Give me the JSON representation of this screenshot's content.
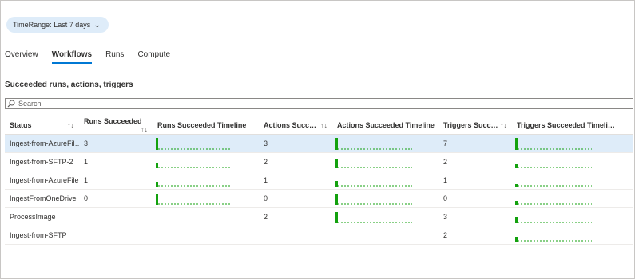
{
  "filter": {
    "label": "TimeRange: Last 7 days",
    "icon": "chevron-down-icon"
  },
  "tabs": [
    {
      "label": "Overview",
      "active": false
    },
    {
      "label": "Workflows",
      "active": true
    },
    {
      "label": "Runs",
      "active": false
    },
    {
      "label": "Compute",
      "active": false
    }
  ],
  "section_title": "Succeeded runs, actions, triggers",
  "search": {
    "placeholder": "Search",
    "value": "",
    "icon": "search-icon"
  },
  "table": {
    "columns": [
      {
        "label": "Status",
        "sortable": true
      },
      {
        "label": "Runs Succeeded",
        "sortable": true
      },
      {
        "label": "Runs Succeeded Timeline",
        "sortable": false
      },
      {
        "label": "Actions Succeed…",
        "sortable": true
      },
      {
        "label": "Actions Succeeded Timeline",
        "sortable": false
      },
      {
        "label": "Triggers Succee…",
        "sortable": true
      },
      {
        "label": "Triggers Succeeded Timeli…",
        "sortable": false
      }
    ],
    "sort_icon": "↑↓",
    "spark_color": "#13a10e",
    "rows": [
      {
        "name": "Ingest-from-AzureFil…",
        "runs": "3",
        "runs_level": 1.0,
        "actions": "3",
        "actions_level": 1.0,
        "triggers": "7",
        "triggers_level": 1.0,
        "selected": true
      },
      {
        "name": "Ingest-from-SFTP-2",
        "runs": "1",
        "runs_level": 0.4,
        "actions": "2",
        "actions_level": 0.75,
        "triggers": "2",
        "triggers_level": 0.35,
        "selected": false
      },
      {
        "name": "Ingest-from-AzureFile",
        "runs": "1",
        "runs_level": 0.4,
        "actions": "1",
        "actions_level": 0.45,
        "triggers": "1",
        "triggers_level": 0.2,
        "selected": false
      },
      {
        "name": "IngestFromOneDrive",
        "runs": "0",
        "runs_level": 0.9,
        "actions": "0",
        "actions_level": 0.9,
        "triggers": "0",
        "triggers_level": 0.3,
        "selected": false
      },
      {
        "name": "ProcessImage",
        "runs": "",
        "runs_level": null,
        "actions": "2",
        "actions_level": 0.9,
        "triggers": "3",
        "triggers_level": 0.5,
        "selected": false
      },
      {
        "name": "Ingest-from-SFTP",
        "runs": "",
        "runs_level": null,
        "actions": "",
        "actions_level": null,
        "triggers": "2",
        "triggers_level": 0.4,
        "selected": false
      }
    ]
  }
}
